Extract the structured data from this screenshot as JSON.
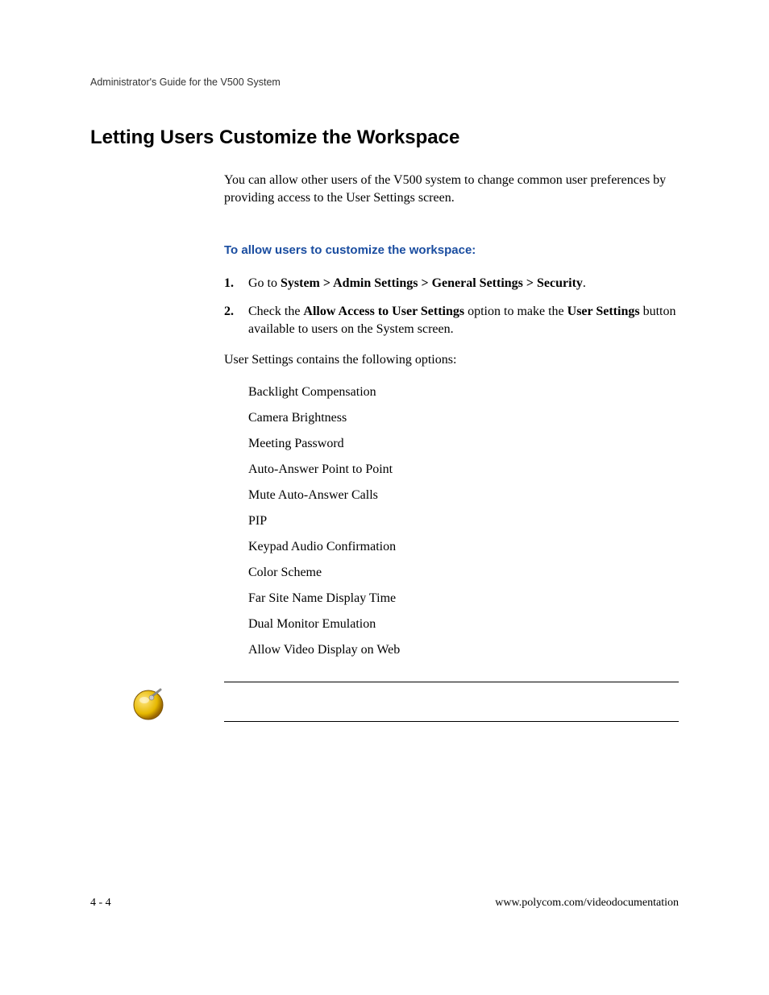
{
  "header": {
    "running": "Administrator's Guide for the V500 System"
  },
  "section": {
    "heading": "Letting Users Customize the Workspace",
    "intro": "You can allow other users of the V500 system to change common user preferences by providing access to the User Settings screen.",
    "task_heading": "To allow users to customize the workspace:",
    "steps": {
      "s1_num": "1.",
      "s1_pre": "Go to ",
      "s1_bold": "System > Admin Settings > General Settings > Security",
      "s1_post": ".",
      "s2_num": "2.",
      "s2_pre": "Check the ",
      "s2_bold1": "Allow Access to User Settings",
      "s2_mid": " option to make the ",
      "s2_bold2": "User Settings",
      "s2_post": " button available to users on the System screen."
    },
    "after_steps": "User Settings contains the following options:",
    "options": {
      "o0": "Backlight Compensation",
      "o1": "Camera Brightness",
      "o2": "Meeting Password",
      "o3": "Auto-Answer Point to Point",
      "o4": "Mute Auto-Answer Calls",
      "o5": "PIP",
      "o6": "Keypad Audio Confirmation",
      "o7": "Color Scheme",
      "o8": "Far Site Name Display Time",
      "o9": "Dual Monitor Emulation",
      "o10": "Allow Video Display on Web"
    }
  },
  "footer": {
    "page_num": "4 - 4",
    "url": "www.polycom.com/videodocumentation"
  }
}
